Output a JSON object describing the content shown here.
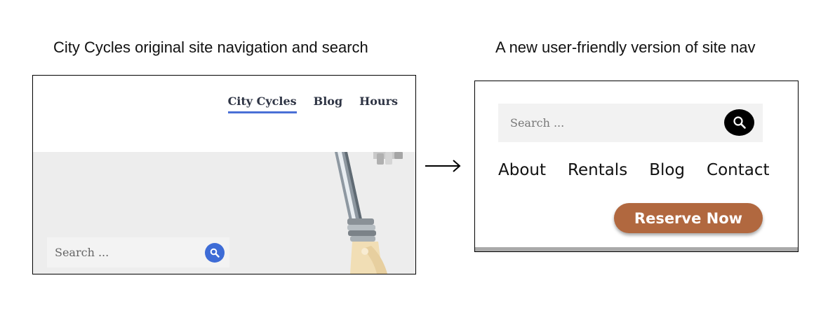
{
  "captions": {
    "left": "City Cycles original site navigation and search",
    "right": "A new user-friendly version of site nav"
  },
  "old_site": {
    "nav": [
      {
        "label": "City Cycles",
        "active": true
      },
      {
        "label": "Blog",
        "active": false
      },
      {
        "label": "Hours",
        "active": false
      }
    ],
    "search": {
      "placeholder": "Search ..."
    },
    "icons": {
      "search": "search-icon"
    },
    "colors": {
      "nav_text": "#2f3545",
      "active_underline": "#4a6fd6",
      "search_button": "#3e6cd6",
      "hero_bg": "#ededed"
    }
  },
  "arrow": {
    "icon": "right-arrow-icon"
  },
  "new_site": {
    "search": {
      "placeholder": "Search ..."
    },
    "icons": {
      "search": "search-icon"
    },
    "nav": [
      {
        "label": "About"
      },
      {
        "label": "Rentals"
      },
      {
        "label": "Blog"
      },
      {
        "label": "Contact"
      }
    ],
    "cta": {
      "label": "Reserve Now"
    },
    "colors": {
      "cta_bg": "#b1683f",
      "search_button": "#000000",
      "search_bg": "#f2f2f2"
    }
  }
}
